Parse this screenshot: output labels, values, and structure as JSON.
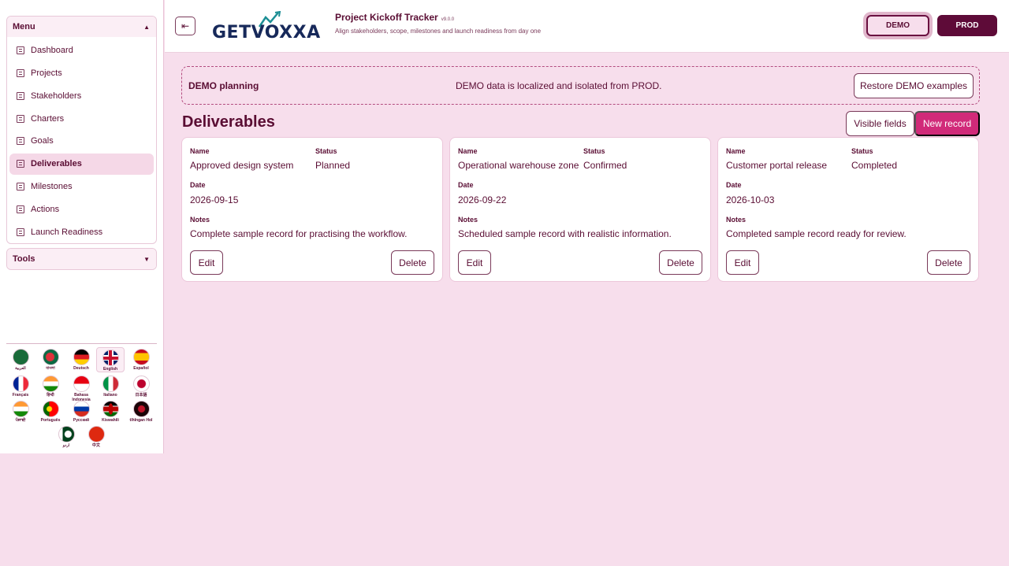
{
  "sidebar": {
    "menu_title": "Menu",
    "tools_title": "Tools",
    "items": [
      {
        "label": "Dashboard"
      },
      {
        "label": "Projects"
      },
      {
        "label": "Stakeholders"
      },
      {
        "label": "Charters"
      },
      {
        "label": "Goals"
      },
      {
        "label": "Deliverables",
        "active": true
      },
      {
        "label": "Milestones"
      },
      {
        "label": "Actions"
      },
      {
        "label": "Launch Readiness"
      }
    ],
    "languages": [
      {
        "label": "العربية",
        "flag": "saudi-arabia"
      },
      {
        "label": "বাংলা",
        "flag": "bangladesh"
      },
      {
        "label": "Deutsch",
        "flag": "germany"
      },
      {
        "label": "English",
        "flag": "uk",
        "selected": true
      },
      {
        "label": "Español",
        "flag": "spain"
      },
      {
        "label": "Français",
        "flag": "france"
      },
      {
        "label": "हिन्दी",
        "flag": "india"
      },
      {
        "label": "Bahasa Indonesia",
        "flag": "indonesia"
      },
      {
        "label": "Italiano",
        "flag": "italy"
      },
      {
        "label": "日本語",
        "flag": "japan"
      },
      {
        "label": "ਪੰਜਾਬੀ",
        "flag": "india"
      },
      {
        "label": "Português",
        "flag": "portugal"
      },
      {
        "label": "Русский",
        "flag": "russia"
      },
      {
        "label": "Kiswahili",
        "flag": "kenya"
      },
      {
        "label": "tlhIngan Hol",
        "flag": "klingon"
      },
      {
        "label": "اردو",
        "flag": "pakistan"
      },
      {
        "label": "中文",
        "flag": "china"
      }
    ]
  },
  "header": {
    "logo_text": "GETVOXXA",
    "title": "Project Kickoff Tracker",
    "version": "v9.0.0",
    "subtitle": "Align stakeholders, scope, milestones and launch readiness from day one",
    "env_demo": "DEMO",
    "env_prod": "PROD"
  },
  "banner": {
    "title": "DEMO planning",
    "text": "DEMO data is localized and isolated from PROD.",
    "restore_label": "Restore DEMO examples"
  },
  "page": {
    "title": "Deliverables",
    "visible_fields_label": "Visible fields",
    "new_record_label": "New record"
  },
  "labels": {
    "name": "Name",
    "status": "Status",
    "date": "Date",
    "notes": "Notes",
    "edit": "Edit",
    "delete": "Delete"
  },
  "records": [
    {
      "name": "Approved design system",
      "status": "Planned",
      "date": "2026-09-15",
      "notes": "Complete sample record for practising the workflow."
    },
    {
      "name": "Operational warehouse zone",
      "status": "Confirmed",
      "date": "2026-09-22",
      "notes": "Scheduled sample record with realistic information."
    },
    {
      "name": "Customer portal release",
      "status": "Completed",
      "date": "2026-10-03",
      "notes": "Completed sample record ready for review."
    }
  ],
  "colors": {
    "background": "#f7deec",
    "brand_dark": "#5e0b38",
    "accent": "#d12a79"
  }
}
